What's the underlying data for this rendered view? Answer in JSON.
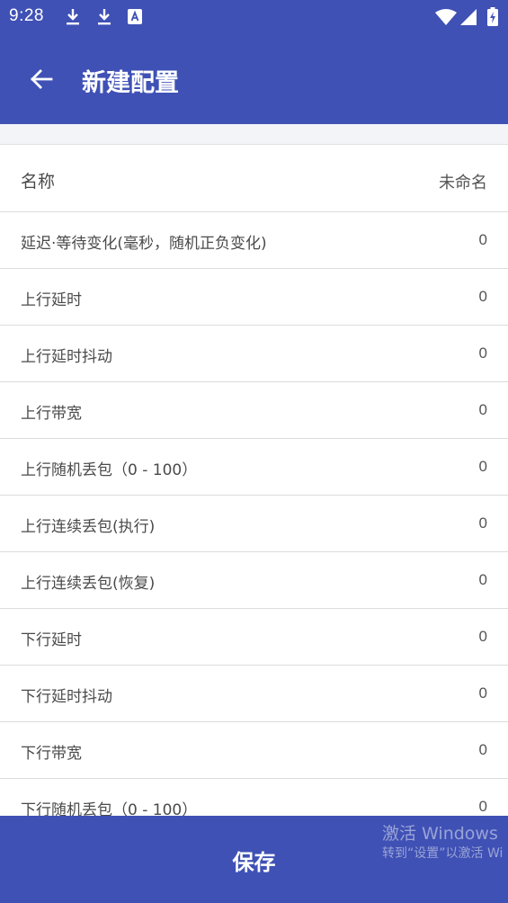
{
  "status_bar": {
    "time": "9:28",
    "left_icons": [
      "download-icon",
      "download-icon",
      "app-notification-icon"
    ],
    "right_icons": [
      "wifi-icon",
      "signal-icon",
      "battery-charging-icon"
    ]
  },
  "app_bar": {
    "title": "新建配置",
    "back_icon": "arrow-left-icon"
  },
  "name_row": {
    "label": "名称",
    "value": "未命名"
  },
  "settings": [
    {
      "label": "延迟·等待变化(毫秒，随机正负变化)",
      "value": "0"
    },
    {
      "label": "上行延时",
      "value": "0"
    },
    {
      "label": "上行延时抖动",
      "value": "0"
    },
    {
      "label": "上行带宽",
      "value": "0"
    },
    {
      "label": "上行随机丢包（0 - 100）",
      "value": "0"
    },
    {
      "label": "上行连续丢包(执行)",
      "value": "0"
    },
    {
      "label": "上行连续丢包(恢复)",
      "value": "0"
    },
    {
      "label": "下行延时",
      "value": "0"
    },
    {
      "label": "下行延时抖动",
      "value": "0"
    },
    {
      "label": "下行带宽",
      "value": "0"
    },
    {
      "label": "下行随机丢包（0 - 100）",
      "value": "0"
    }
  ],
  "save_button": {
    "label": "保存"
  },
  "watermark": {
    "line1": "激活 Windows",
    "line2": "转到“设置”以激活 Wi"
  },
  "colors": {
    "primary": "#3f51b5",
    "background": "#ffffff",
    "section_bg": "#f3f4f8",
    "text": "#4a4a4a"
  }
}
